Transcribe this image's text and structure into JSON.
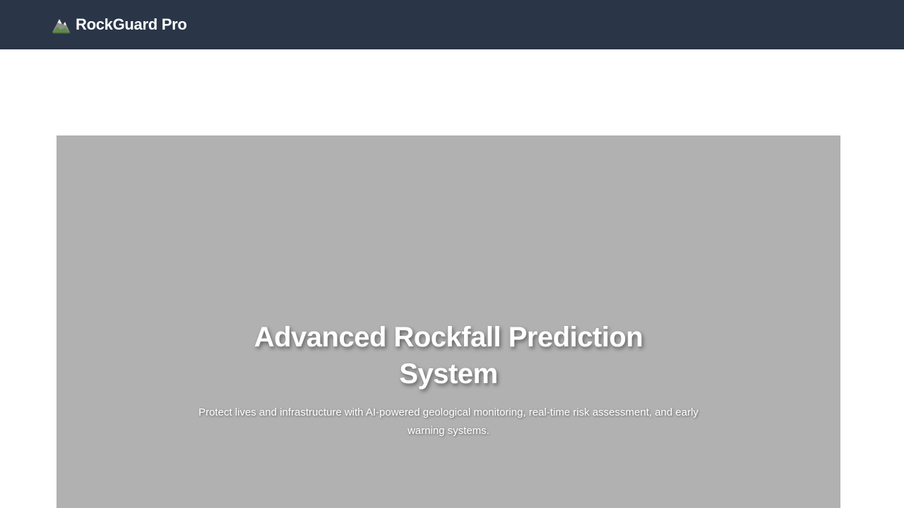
{
  "header": {
    "brand_name": "RockGuard Pro",
    "brand_icon": "mountain-icon"
  },
  "hero": {
    "title": "Advanced Rockfall Prediction System",
    "subtitle": "Protect lives and infrastructure with AI-powered geological monitoring, real-time risk assessment, and early warning systems."
  },
  "colors": {
    "header_background": "#2a3547",
    "hero_background": "#b1b1b1",
    "text": "#ffffff"
  }
}
